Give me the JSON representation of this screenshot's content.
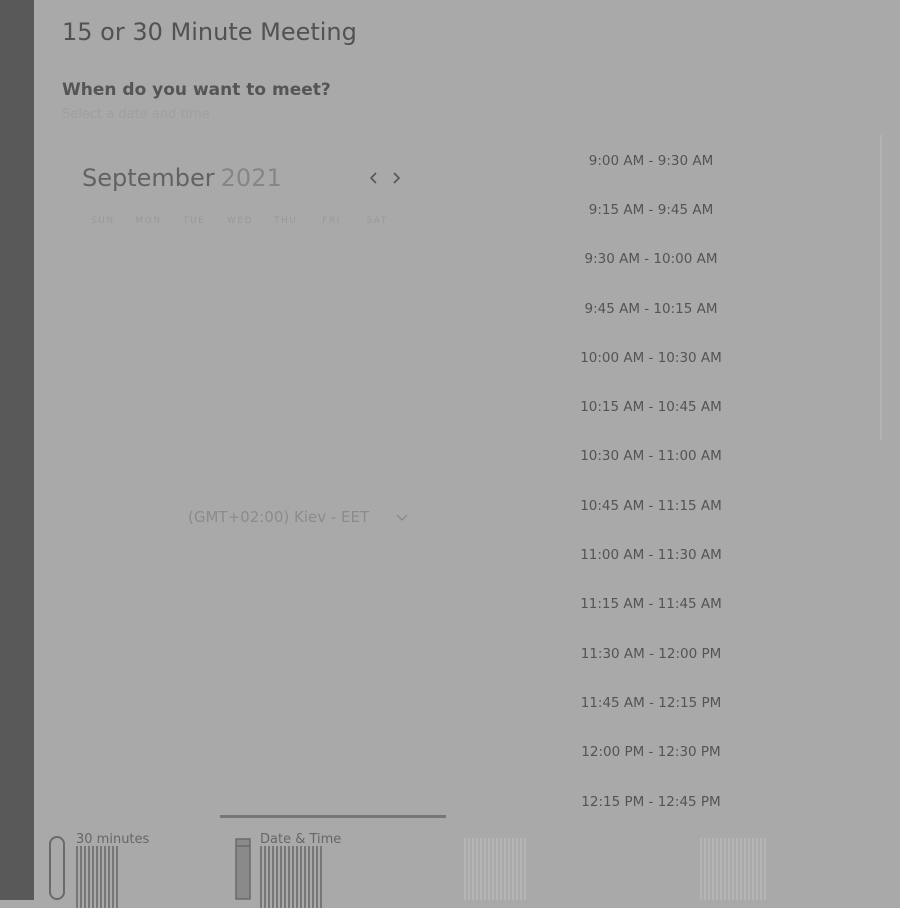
{
  "meeting": {
    "title": "15 or 30 Minute Meeting",
    "question": "When do you want to meet?",
    "subtitle": "Select a date and time"
  },
  "calendar": {
    "month": "September",
    "year": "2021",
    "weekdays": [
      "SUN",
      "MON",
      "TUE",
      "WED",
      "THU",
      "FRI",
      "SAT"
    ]
  },
  "timezone": {
    "selected": "(GMT+02:00) Kiev - EET"
  },
  "slots": [
    "9:00 AM - 9:30 AM",
    "9:15 AM - 9:45 AM",
    "9:30 AM - 10:00 AM",
    "9:45 AM - 10:15 AM",
    "10:00 AM - 10:30 AM",
    "10:15 AM - 10:45 AM",
    "10:30 AM - 11:00 AM",
    "10:45 AM - 11:15 AM",
    "11:00 AM - 11:30 AM",
    "11:15 AM - 11:45 AM",
    "11:30 AM - 12:00 PM",
    "11:45 AM - 12:15 PM",
    "12:00 PM - 12:30 PM",
    "12:15 PM - 12:45 PM"
  ],
  "footer": {
    "duration_label": "30 minutes",
    "datetime_label": "Date & Time"
  },
  "icons": {
    "prev": "chevron-left-icon",
    "next": "chevron-right-icon",
    "timezone": "chevron-down-icon",
    "duration": "clock-icon",
    "datetime": "calendar-icon"
  }
}
